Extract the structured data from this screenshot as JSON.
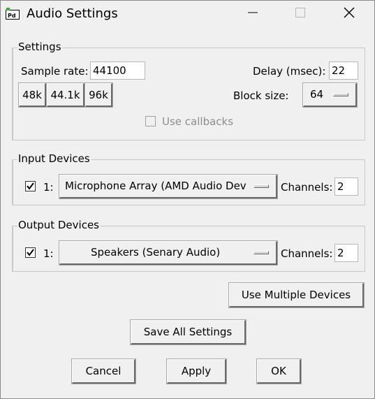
{
  "window": {
    "title": "Audio Settings",
    "app_icon_text": "Pd",
    "controls": {
      "minimize": "minimize-icon",
      "maximize": "maximize-icon",
      "close": "close-icon"
    }
  },
  "settings": {
    "label": "Settings",
    "sample_rate_label": "Sample rate:",
    "sample_rate_value": "44100",
    "rate_buttons": [
      "48k",
      "44.1k",
      "96k"
    ],
    "delay_label": "Delay (msec):",
    "delay_value": "22",
    "block_size_label": "Block size:",
    "block_size_value": "64",
    "use_callbacks_label": "Use callbacks",
    "use_callbacks_checked": false
  },
  "input_devices": {
    "label": "Input Devices",
    "checked": true,
    "index_label": "1:",
    "device": "Microphone Array (AMD Audio Dev",
    "channels_label": "Channels:",
    "channels_value": "2"
  },
  "output_devices": {
    "label": "Output Devices",
    "checked": true,
    "index_label": "1:",
    "device": "Speakers (Senary Audio)",
    "channels_label": "Channels:",
    "channels_value": "2"
  },
  "buttons": {
    "use_multiple_devices": "Use Multiple Devices",
    "save_all_settings": "Save All Settings",
    "cancel": "Cancel",
    "apply": "Apply",
    "ok": "OK"
  }
}
